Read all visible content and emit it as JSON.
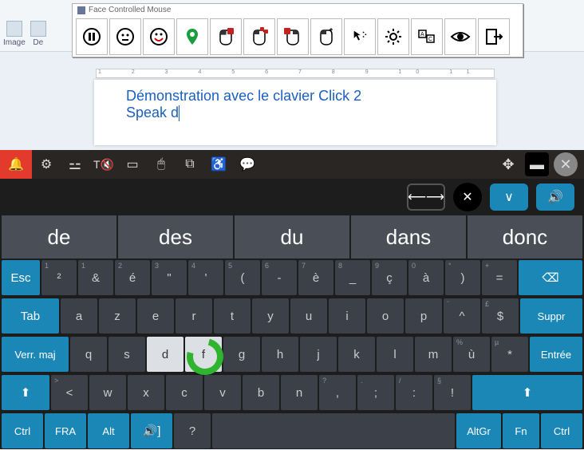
{
  "fcm": {
    "title": "Face Controlled Mouse"
  },
  "document": {
    "line1": "Démonstration avec le clavier Click 2",
    "line2": "Speak d"
  },
  "osk": {
    "util": {
      "bksp_label": "⟵⟶",
      "close": "✕",
      "down": "∨",
      "vol": "🔊"
    },
    "suggestions": [
      "de",
      "des",
      "du",
      "dans",
      "donc"
    ],
    "row1": {
      "esc": "Esc",
      "keys": [
        {
          "m": "&",
          "s": "1",
          "t": "²"
        },
        {
          "m": "é",
          "s": "2",
          "t": ""
        },
        {
          "m": "\"",
          "s": "3",
          "t": ""
        },
        {
          "m": "'",
          "s": "4",
          "t": ""
        },
        {
          "m": "(",
          "s": "5",
          "t": ""
        },
        {
          "m": "-",
          "s": "6",
          "t": ""
        },
        {
          "m": "è",
          "s": "7",
          "t": ""
        },
        {
          "m": "_",
          "s": "8",
          "t": ""
        },
        {
          "m": "ç",
          "s": "9",
          "t": ""
        },
        {
          "m": "à",
          "s": "0",
          "t": ""
        },
        {
          "m": ")",
          "s": "°",
          "t": ""
        },
        {
          "m": "=",
          "s": "+",
          "t": ""
        }
      ],
      "back": "⌫"
    },
    "row2": {
      "tab": "Tab",
      "keys": [
        "a",
        "z",
        "e",
        "r",
        "t",
        "y",
        "u",
        "i",
        "o",
        "p",
        "^",
        "$"
      ],
      "sup": [
        "",
        "",
        "",
        "",
        "",
        "",
        "",
        "",
        "",
        "",
        "¨",
        "£"
      ],
      "suppr": "Suppr"
    },
    "row3": {
      "caps": "Verr. maj",
      "keys": [
        "q",
        "s",
        "d",
        "f",
        "g",
        "h",
        "j",
        "k",
        "l",
        "m",
        "ù",
        "*"
      ],
      "sup": [
        "",
        "",
        "",
        "",
        "",
        "",
        "",
        "",
        "",
        "",
        "%",
        "µ"
      ],
      "enter": "Entrée"
    },
    "row4": {
      "shiftIcon": "⬆",
      "lt": "<",
      "ltSup": ">",
      "keys": [
        "w",
        "x",
        "c",
        "v",
        "b",
        "n",
        ",",
        ";",
        ":",
        "!"
      ],
      "sup": [
        "",
        "",
        "",
        "",
        "",
        "",
        "?",
        ".",
        "/",
        "§"
      ],
      "shiftR": "⬆"
    },
    "row5": {
      "ctrl": "Ctrl",
      "fra": "FRA",
      "alt": "Alt",
      "speak": "🔊]",
      "q": "?",
      "altgr": "AltGr",
      "fn": "Fn",
      "ctrlR": "Ctrl"
    }
  }
}
